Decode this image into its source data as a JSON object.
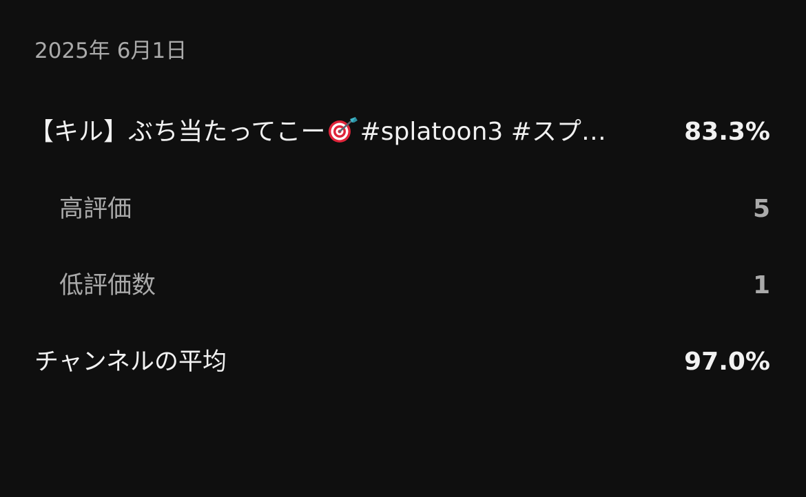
{
  "report": {
    "date": "2025年 6月1日",
    "video": {
      "title_prefix": "【キル】ぶち当たってこー",
      "title_suffix": "#splatoon3 #スプ…",
      "emoji_icon": "direct-hit-target-icon",
      "ratio": "83.3%"
    },
    "likes": {
      "label": "高評価",
      "value": "5"
    },
    "dislikes": {
      "label": "低評価数",
      "value": "1"
    },
    "channel_average": {
      "label": "チャンネルの平均",
      "value": "97.0%"
    }
  },
  "colors": {
    "background": "#0f0f0f",
    "primary_text": "#f1f1f1",
    "secondary_text": "#aaaaaa",
    "target_red": "#e0243a",
    "dart_teal": "#3fb6c9"
  }
}
